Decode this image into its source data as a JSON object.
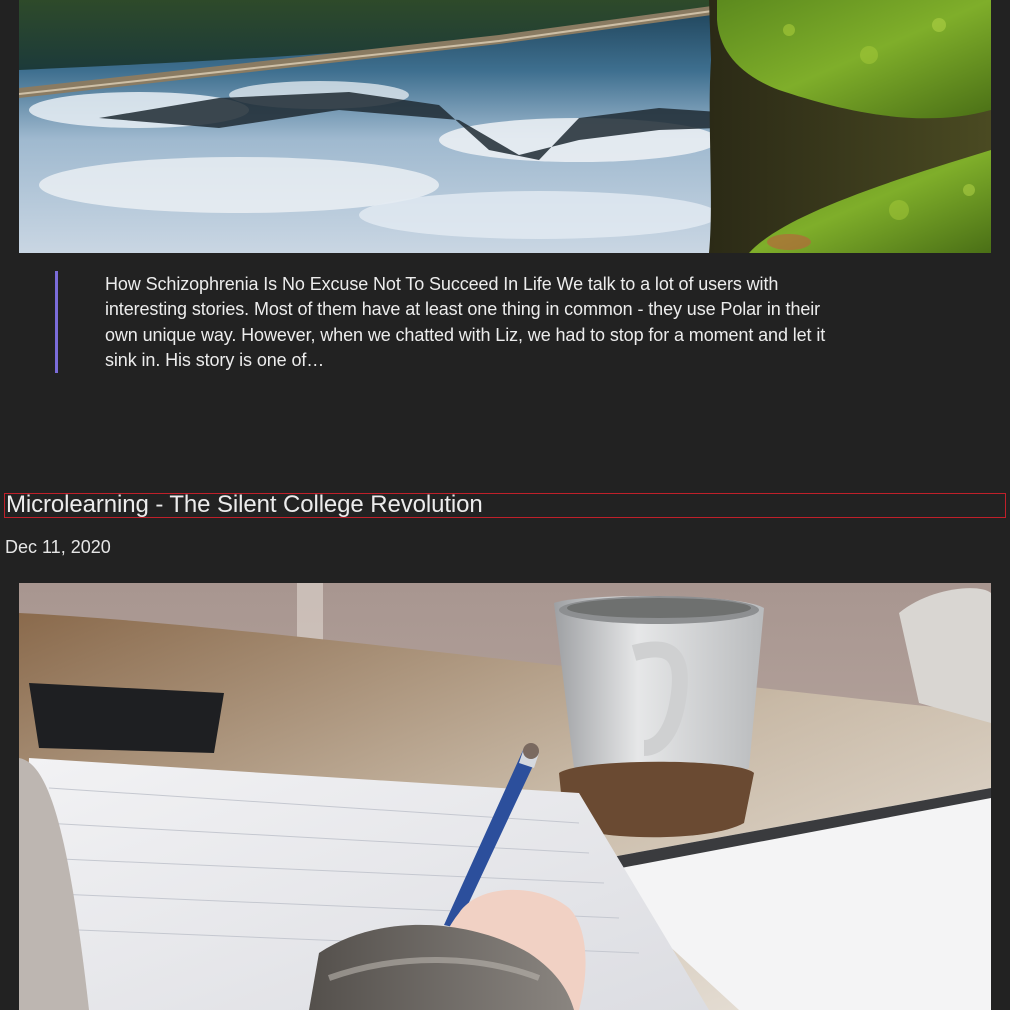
{
  "previous_post": {
    "image_alt": "Mountain reflected in a lake beside a moss-covered stump",
    "excerpt": "How Schizophrenia Is No Excuse Not To Succeed In Life We talk to a lot of users with interesting stories. Most of them have at least one thing in common - they use Polar in their own unique way. However, when we chatted with Liz, we had to stop for a moment and let it sink in. His story is one of…"
  },
  "post": {
    "title": "Microlearning - The Silent College Revolution",
    "date": "Dec 11, 2020",
    "image_alt": "Hand writing with a blue pen on paper next to a coffee cup"
  },
  "colors": {
    "background": "#222222",
    "quote_border": "#7b6cd9",
    "title_outline": "#c0202a"
  }
}
